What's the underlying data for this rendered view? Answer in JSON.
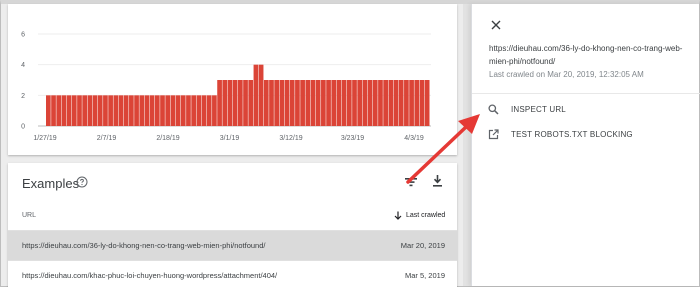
{
  "chart_data": {
    "type": "bar",
    "title": "",
    "xlabel": "",
    "ylabel": "",
    "ylim": [
      0,
      6
    ],
    "yticks": [
      0,
      2,
      4,
      6
    ],
    "x_tick_labels": [
      "1/27/19",
      "2/7/19",
      "2/18/19",
      "3/1/19",
      "3/12/19",
      "3/23/19",
      "4/3/19"
    ],
    "bar_color": "#db4437",
    "values": [
      2,
      2,
      2,
      2,
      2,
      2,
      2,
      2,
      2,
      2,
      2,
      2,
      2,
      2,
      2,
      2,
      2,
      2,
      2,
      2,
      2,
      2,
      2,
      2,
      2,
      2,
      2,
      2,
      2,
      2,
      2,
      2,
      2,
      3,
      3,
      3,
      3,
      3,
      3,
      3,
      4,
      4,
      3,
      3,
      3,
      3,
      3,
      3,
      3,
      3,
      3,
      3,
      3,
      3,
      3,
      3,
      3,
      3,
      3,
      3,
      3,
      3,
      3,
      3,
      3,
      3,
      3,
      3,
      3,
      3,
      3,
      3,
      3,
      3
    ]
  },
  "examples": {
    "title": "Examples",
    "help_icon": "help-circle-icon",
    "filter_icon": "filter-icon",
    "download_icon": "download-icon",
    "col_url": "URL",
    "col_crawled": "Last crawled",
    "rows": [
      {
        "url": "https://dieuhau.com/36-ly-do-khong-nen-co-trang-web-mien-phi/notfound/",
        "date": "Mar 20, 2019",
        "selected": true
      },
      {
        "url": "https://dieuhau.com/khac-phuc-loi-chuyen-huong-wordpress/attachment/404/",
        "date": "Mar 5, 2019",
        "selected": false
      }
    ]
  },
  "panel": {
    "close_icon": "close-icon",
    "url": "https://dieuhau.com/36-ly-do-khong-nen-co-trang-web-mien-phi/notfound/",
    "last_crawled": "Last crawled on Mar 20, 2019, 12:32:05 AM",
    "actions": [
      {
        "label": "INSPECT URL",
        "icon": "search-icon"
      },
      {
        "label": "TEST ROBOTS.TXT BLOCKING",
        "icon": "open-in-new-icon"
      }
    ]
  },
  "colors": {
    "accent_red": "#e53935",
    "selected_row": "#dadada"
  }
}
